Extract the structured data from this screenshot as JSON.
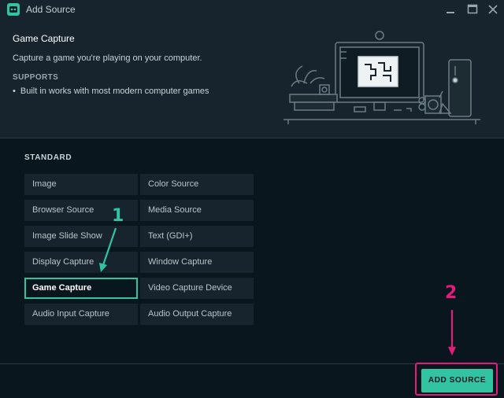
{
  "window": {
    "title": "Add Source",
    "icon": "robot-face-icon",
    "controls": [
      "minimize-icon",
      "maximize-icon",
      "close-icon"
    ]
  },
  "source_info": {
    "title": "Game Capture",
    "description": "Capture a game you're playing on your computer.",
    "supports_label": "SUPPORTS",
    "supports": [
      "Built in works with most modern computer games"
    ]
  },
  "sources": {
    "category": "STANDARD",
    "left_column": [
      "Image",
      "Browser Source",
      "Image Slide Show",
      "Display Capture",
      "Game Capture",
      "Audio Input Capture"
    ],
    "right_column": [
      "Color Source",
      "Media Source",
      "Text (GDI+)",
      "Window Capture",
      "Video Capture Device",
      "Audio Output Capture"
    ],
    "selected": "Game Capture"
  },
  "annotations": {
    "step1": "1",
    "step2": "2",
    "step1_color": "#31c3a2",
    "step2_color": "#e8197d"
  },
  "footer": {
    "add_button": "ADD SOURCE"
  },
  "colors": {
    "accent": "#31c3a2",
    "background": "#09161d",
    "panel": "#17242d",
    "highlight": "#e8197d"
  }
}
